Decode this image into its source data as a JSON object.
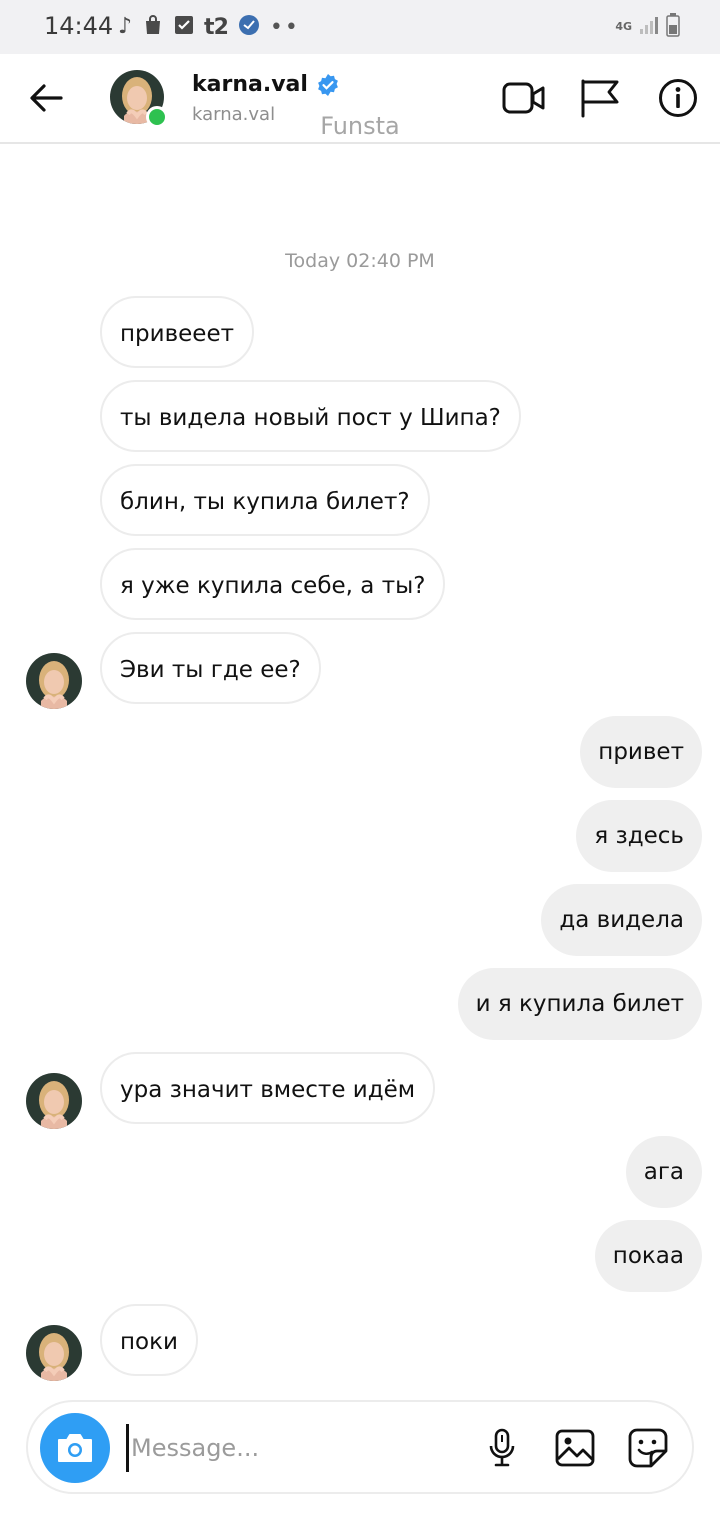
{
  "status_bar": {
    "time": "14:44",
    "icons_left": [
      "music-note-icon",
      "shopping-bag-icon",
      "checkbox-icon",
      "t2-carrier-icon",
      "vpn-icon",
      "more-dots-icon"
    ],
    "carrier": "t2",
    "network": "4G",
    "icons_right": [
      "signal-icon",
      "battery-icon"
    ]
  },
  "header": {
    "username": "karna.val",
    "subname": "karna.val",
    "verified": true,
    "online": true,
    "watermark": "Funsta",
    "actions": [
      "video-call",
      "report-flag",
      "info"
    ]
  },
  "chat": {
    "timestamp": "Today 02:40 PM",
    "messages": [
      {
        "side": "in",
        "text": "привееет"
      },
      {
        "side": "in",
        "text": "ты видела новый пост у Шипа?"
      },
      {
        "side": "in",
        "text": "блин, ты купила билет?"
      },
      {
        "side": "in",
        "text": "я уже купила себе, а ты?"
      },
      {
        "side": "in",
        "text": "Эви ты где ее?"
      },
      {
        "side": "out",
        "text": "привет"
      },
      {
        "side": "out",
        "text": "я здесь"
      },
      {
        "side": "out",
        "text": "да видела"
      },
      {
        "side": "out",
        "text": "и я купила билет"
      },
      {
        "side": "in",
        "text": "ура значит вместе идём"
      },
      {
        "side": "out",
        "text": "ага"
      },
      {
        "side": "out",
        "text": "покаа"
      },
      {
        "side": "in",
        "text": "поки"
      }
    ]
  },
  "composer": {
    "placeholder": "Message...",
    "value": ""
  },
  "colors": {
    "accent": "#2f9ef4",
    "verified": "#3897f0",
    "online": "#2ec150",
    "outgoing_bubble": "#efefef",
    "incoming_border": "#ececec"
  }
}
